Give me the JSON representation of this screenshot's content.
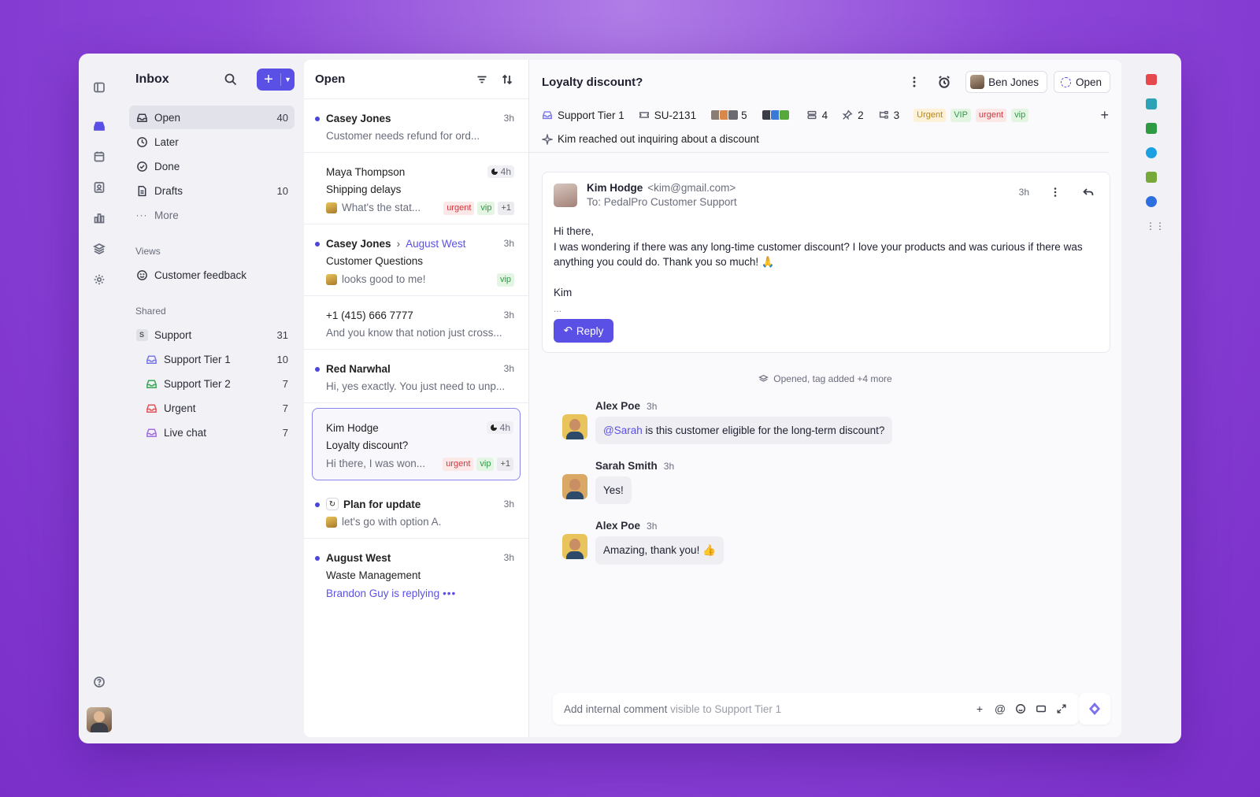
{
  "sidebar": {
    "title": "Inbox",
    "nav": [
      {
        "label": "Open",
        "count": "40"
      },
      {
        "label": "Later",
        "count": ""
      },
      {
        "label": "Done",
        "count": ""
      },
      {
        "label": "Drafts",
        "count": "10"
      },
      {
        "label": "More",
        "count": ""
      }
    ],
    "views_label": "Views",
    "views": [
      {
        "label": "Customer feedback"
      }
    ],
    "shared_label": "Shared",
    "shared": [
      {
        "label": "Support",
        "count": "31",
        "badge": "S"
      },
      {
        "label": "Support Tier 1",
        "count": "10",
        "color": "#7a78e6"
      },
      {
        "label": "Support Tier 2",
        "count": "7",
        "color": "#3aa655"
      },
      {
        "label": "Urgent",
        "count": "7",
        "color": "#e0555a"
      },
      {
        "label": "Live chat",
        "count": "7",
        "color": "#a070e0"
      }
    ]
  },
  "list": {
    "title": "Open",
    "items": [
      {
        "from": "Casey Jones",
        "time": "3h",
        "subject": "",
        "preview": "Customer needs refund for ord..."
      },
      {
        "from": "Maya Thompson",
        "time": "4h",
        "subject": "Shipping delays",
        "preview": "What's the stat...",
        "tags": [
          "urgent",
          "vip",
          "+1"
        ]
      },
      {
        "from": "Casey Jones",
        "to": "August West",
        "time": "3h",
        "subject": "Customer Questions",
        "preview": "looks good to me!",
        "tags": [
          "vip"
        ]
      },
      {
        "from": "+1 (415) 666 7777",
        "time": "3h",
        "subject": "",
        "preview": "And you know that notion just cross..."
      },
      {
        "from": "Red Narwhal",
        "time": "3h",
        "subject": "",
        "preview": "Hi, yes exactly. You just need to unp..."
      },
      {
        "from": "Kim Hodge",
        "time": "4h",
        "subject": "Loyalty discount?",
        "preview": "Hi there, I was won...",
        "tags": [
          "urgent",
          "vip",
          "+1"
        ]
      },
      {
        "from": "Plan for update",
        "time": "3h",
        "subject": "",
        "preview": "let's go with option A."
      },
      {
        "from": "August West",
        "time": "3h",
        "subject": "Waste Management",
        "preview": "Brandon Guy is replying"
      }
    ]
  },
  "conversation": {
    "title": "Loyalty discount?",
    "assignee": "Ben Jones",
    "status": "Open",
    "meta": {
      "inbox": "Support Tier 1",
      "ticket": "SU-2131",
      "participants": "5",
      "links": "4",
      "pins": "2",
      "threads": "3",
      "tags": [
        "Urgent",
        "VIP",
        "urgent",
        "vip"
      ]
    },
    "summary": "Kim reached out inquiring about a discount",
    "email": {
      "from_name": "Kim Hodge",
      "from_addr": "<kim@gmail.com>",
      "to": "To: PedalPro Customer Support",
      "time": "3h",
      "greeting": "Hi there,",
      "body": "I was wondering if there was any long-time customer discount? I love your products and was curious if there was anything you could do. Thank you so much! 🙏",
      "signoff": "Kim",
      "ellipsis": "...",
      "reply_label": "Reply"
    },
    "activity": "Opened, tag added +4 more",
    "comments": [
      {
        "author": "Alex Poe",
        "time": "3h",
        "mention": "@Sarah",
        "text": " is this customer eligible for the long-term discount?"
      },
      {
        "author": "Sarah Smith",
        "time": "3h",
        "mention": "",
        "text": "Yes!"
      },
      {
        "author": "Alex Poe",
        "time": "3h",
        "mention": "",
        "text": "Amazing, thank you! 👍"
      }
    ],
    "composer": {
      "placeholder": "Add internal comment",
      "hint": "visible to Support Tier 1"
    }
  },
  "colors": {
    "accent": "#5b50e6",
    "background": "#8c45d8"
  }
}
